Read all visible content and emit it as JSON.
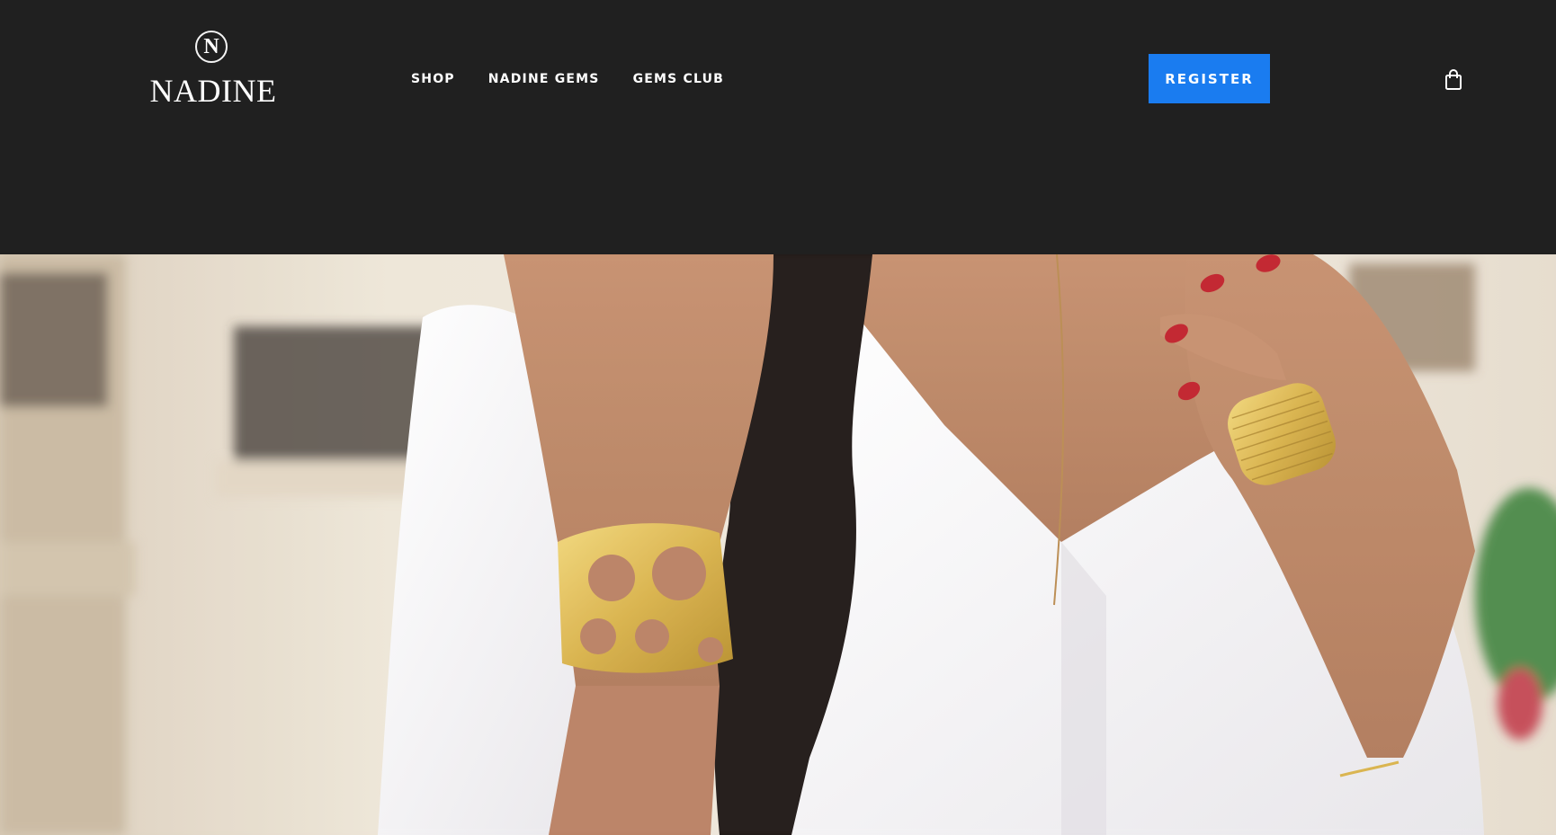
{
  "brand": {
    "monogram": "N",
    "name": "NADINE"
  },
  "nav": {
    "items": [
      {
        "label": "SHOP"
      },
      {
        "label": "NADINE GEMS"
      },
      {
        "label": "GEMS CLUB"
      }
    ]
  },
  "header": {
    "register_label": "REGISTER",
    "cart_icon": "shopping-bag-icon"
  },
  "colors": {
    "header_bg": "#202020",
    "accent": "#1a7cf0",
    "text": "#ffffff"
  },
  "hero": {
    "image": "woman-in-white-blouse-wearing-gold-cuff-and-ring"
  }
}
